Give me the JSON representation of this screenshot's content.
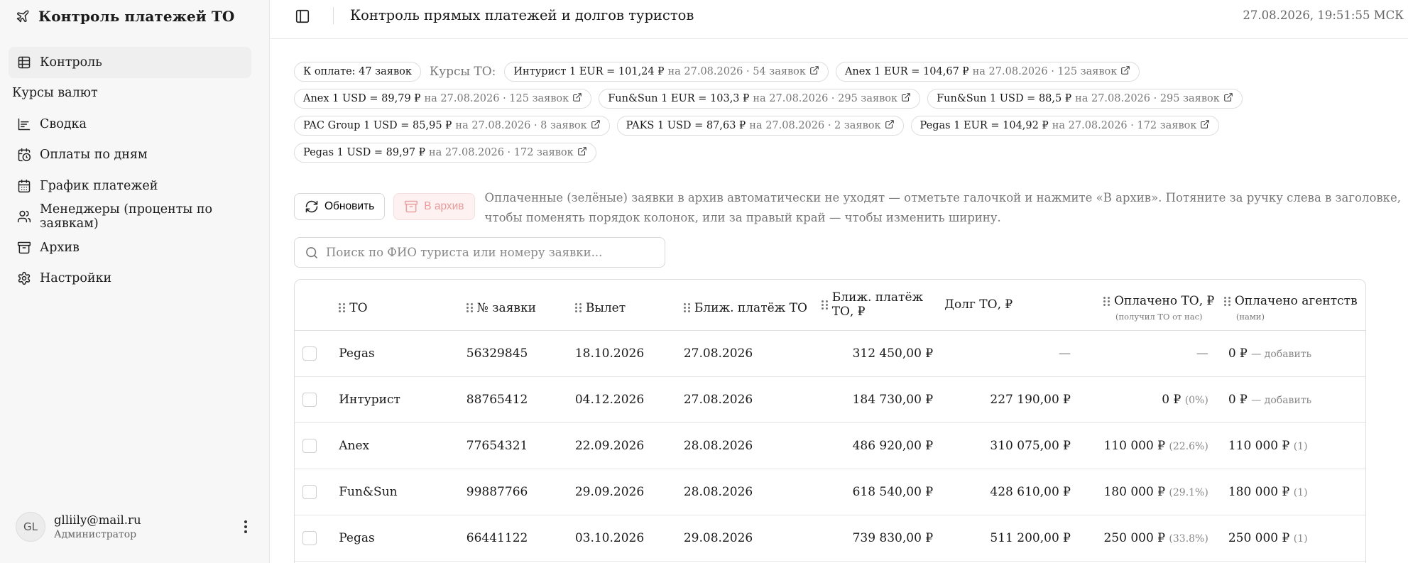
{
  "app": {
    "title": "Контроль платежей ТО"
  },
  "sidebar": {
    "items": [
      {
        "label": "Контроль",
        "icon": "table-icon",
        "active": true
      },
      {
        "label": "Курсы валют",
        "icon": ""
      },
      {
        "label": "Сводка",
        "icon": "chart-icon"
      },
      {
        "label": "Оплаты по дням",
        "icon": "calendar-clock-icon"
      },
      {
        "label": "График платежей",
        "icon": "calendar-icon"
      },
      {
        "label": "Менеджеры (проценты по заявкам)",
        "icon": "users-icon"
      },
      {
        "label": "Архив",
        "icon": "archive-icon"
      },
      {
        "label": "Настройки",
        "icon": "gear-icon"
      }
    ],
    "user": {
      "initials": "GL",
      "email": "glliily@mail.ru",
      "role": "Администратор"
    }
  },
  "header": {
    "title": "Контроль прямых платежей и долгов туристов",
    "datetime": "27.08.2026, 19:51:55 МСК"
  },
  "summary": {
    "to_pay": "К оплате: 47 заявок",
    "rates_label": "Курсы ТО:",
    "rates": [
      {
        "main": "Интурист 1 EUR = 101,24 ₽",
        "meta": "на 27.08.2026 · 54 заявок"
      },
      {
        "main": "Anex 1 EUR = 104,67 ₽",
        "meta": "на 27.08.2026 · 125 заявок"
      },
      {
        "main": "Anex 1 USD = 89,79 ₽",
        "meta": "на 27.08.2026 · 125 заявок"
      },
      {
        "main": "Fun&Sun 1 EUR = 103,3 ₽",
        "meta": "на 27.08.2026 · 295 заявок"
      },
      {
        "main": "Fun&Sun 1 USD = 88,5 ₽",
        "meta": "на 27.08.2026 · 295 заявок"
      },
      {
        "main": "PAC Group 1 USD = 85,95 ₽",
        "meta": "на 27.08.2026 · 8 заявок"
      },
      {
        "main": "PAKS 1 USD = 87,63 ₽",
        "meta": "на 27.08.2026 · 2 заявок"
      },
      {
        "main": "Pegas 1 EUR = 104,92 ₽",
        "meta": "на 27.08.2026 · 172 заявок"
      },
      {
        "main": "Pegas 1 USD = 89,97 ₽",
        "meta": "на 27.08.2026 · 172 заявок"
      }
    ]
  },
  "toolbar": {
    "refresh_label": "Обновить",
    "archive_label": "В архив",
    "hint": "Оплаченные (зелёные) заявки в архив автоматически не уходят — отметьте галочкой и нажмите «В архив». Потяните за ручку слева в заголовке, чтобы поменять порядок колонок, или за правый край — чтобы изменить ширину."
  },
  "search": {
    "placeholder": "Поиск по ФИО туриста или номеру заявки..."
  },
  "table": {
    "columns": {
      "to": "ТО",
      "order": "№ заявки",
      "departure": "Вылет",
      "next_date": "Ближ. платёж ТО",
      "next_amount": "Ближ. платёж ТО, ₽",
      "debt": "Долг ТО, ₽",
      "paid_to": "Оплачено ТО, ₽",
      "paid_to_sub": "(получил ТО от нас)",
      "paid_agency": "Оплачено агентств",
      "paid_agency_sub": "(нами)"
    },
    "rows": [
      {
        "to": "Pegas",
        "order": "56329845",
        "departure": "18.10.2026",
        "next_date": "27.08.2026",
        "next_amount": "312 450,00 ₽",
        "debt": "—",
        "paid_to": "—",
        "paid_to_pct": "",
        "paid_agency": "0 ₽",
        "paid_agency_note": "— добавить"
      },
      {
        "to": "Интурист",
        "order": "88765412",
        "departure": "04.12.2026",
        "next_date": "27.08.2026",
        "next_amount": "184 730,00 ₽",
        "debt": "227 190,00 ₽",
        "paid_to": "0 ₽",
        "paid_to_pct": "(0%)",
        "paid_agency": "0 ₽",
        "paid_agency_note": "— добавить"
      },
      {
        "to": "Anex",
        "order": "77654321",
        "departure": "22.09.2026",
        "next_date": "28.08.2026",
        "next_amount": "486 920,00 ₽",
        "debt": "310 075,00 ₽",
        "paid_to": "110 000 ₽",
        "paid_to_pct": "(22.6%)",
        "paid_agency": "110 000 ₽",
        "paid_agency_note": "(1)"
      },
      {
        "to": "Fun&Sun",
        "order": "99887766",
        "departure": "29.09.2026",
        "next_date": "28.08.2026",
        "next_amount": "618 540,00 ₽",
        "debt": "428 610,00 ₽",
        "paid_to": "180 000 ₽",
        "paid_to_pct": "(29.1%)",
        "paid_agency": "180 000 ₽",
        "paid_agency_note": "(1)"
      },
      {
        "to": "Pegas",
        "order": "66441122",
        "departure": "03.10.2026",
        "next_date": "29.08.2026",
        "next_amount": "739 830,00 ₽",
        "debt": "511 200,00 ₽",
        "paid_to": "250 000 ₽",
        "paid_to_pct": "(33.8%)",
        "paid_agency": "250 000 ₽",
        "paid_agency_note": "(1)"
      }
    ]
  }
}
